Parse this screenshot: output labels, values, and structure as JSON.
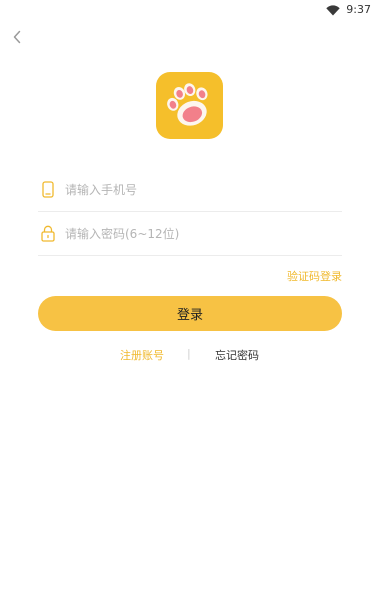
{
  "status_bar": {
    "time": "9:37",
    "wifi_icon": "wifi-icon"
  },
  "back": {
    "icon": "chevron-left-icon"
  },
  "logo": {
    "icon": "paw-icon",
    "bg_color": "#f5bf2b"
  },
  "phone_field": {
    "placeholder": "请输入手机号",
    "value": "",
    "icon": "phone-icon"
  },
  "password_field": {
    "placeholder": "请输入密码(6~12位)",
    "value": "",
    "icon": "lock-icon"
  },
  "code_login": {
    "label": "验证码登录"
  },
  "login_button": {
    "label": "登录"
  },
  "links": {
    "register": "注册账号",
    "separator": "|",
    "forgot": "忘记密码"
  },
  "colors": {
    "accent": "#f7c244",
    "accent_text": "#f0b92e",
    "placeholder": "#b5b5b5"
  }
}
